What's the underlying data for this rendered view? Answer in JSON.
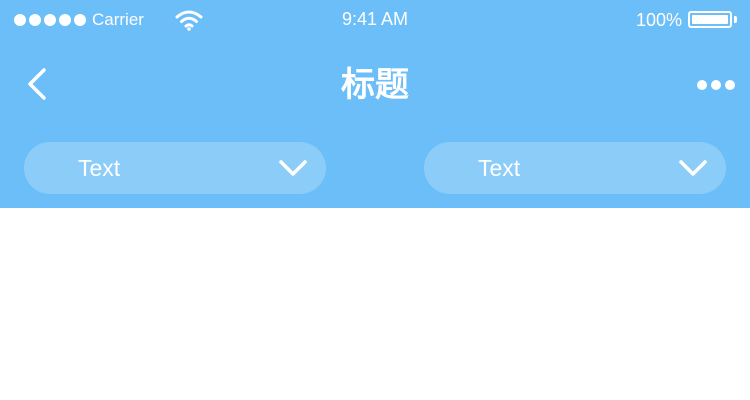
{
  "status_bar": {
    "carrier": "Carrier",
    "time": "9:41 AM",
    "battery": "100%",
    "icons": [
      "signal-dots-icon",
      "wifi-icon",
      "battery-icon"
    ]
  },
  "nav": {
    "title": "标题",
    "back_icon": "chevron-left-icon",
    "more_icon": "more-horizontal-icon"
  },
  "filters": [
    {
      "label": "Text",
      "icon": "chevron-down-icon"
    },
    {
      "label": "Text",
      "icon": "chevron-down-icon"
    }
  ],
  "colors": {
    "header_bg": "#6cbef8",
    "dropdown_bg": "rgba(255,255,255,0.22)",
    "text": "#ffffff",
    "page_bg": "#ffffff"
  }
}
